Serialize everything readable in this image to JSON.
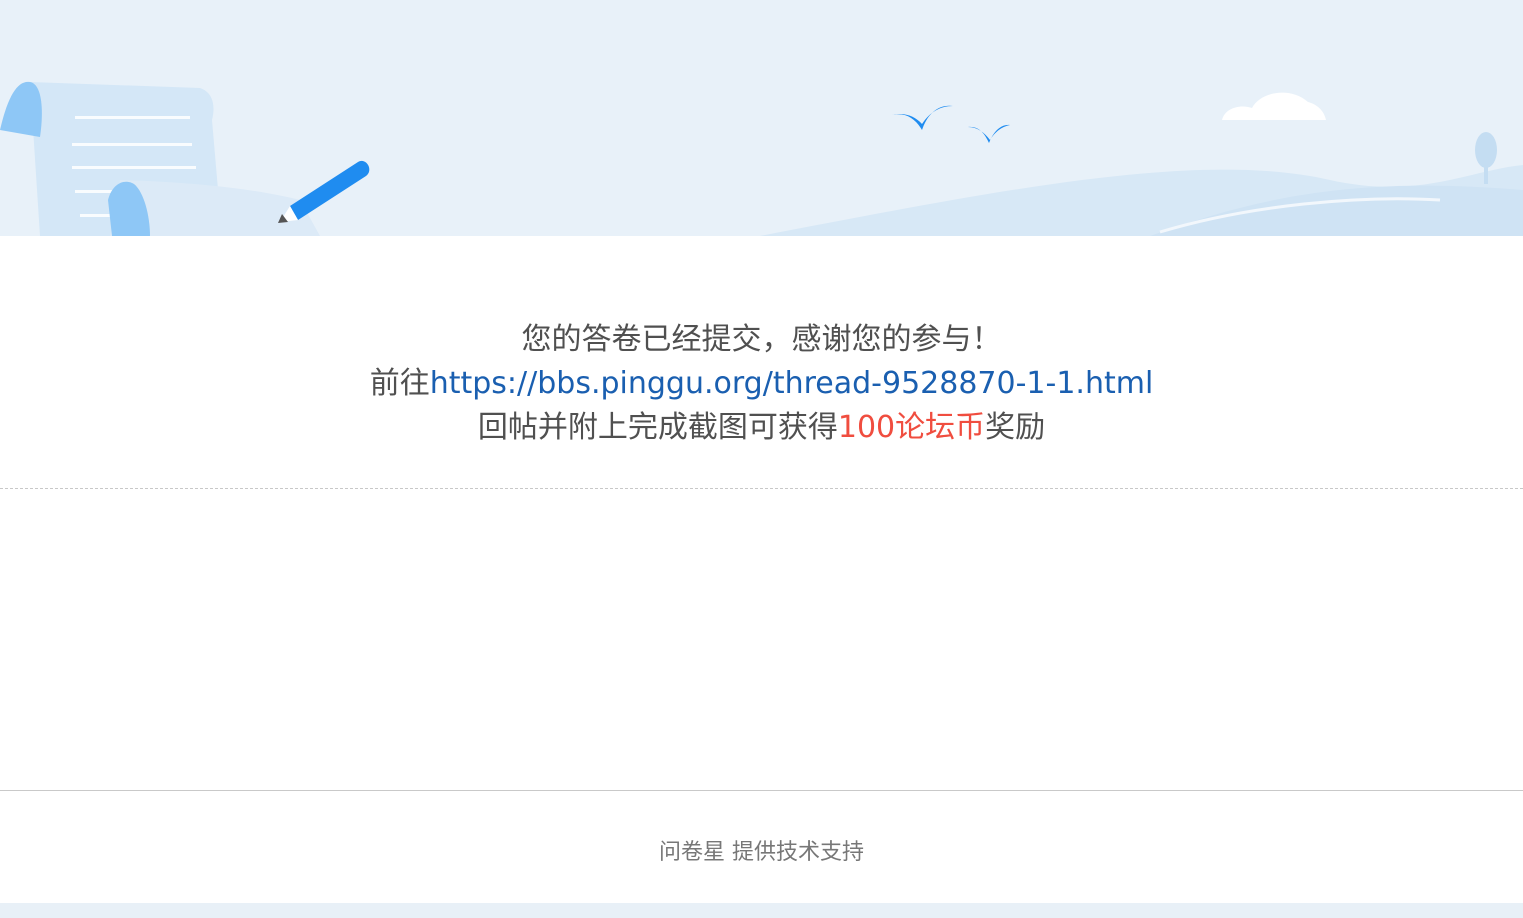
{
  "completion": {
    "line1": "您的答卷已经提交，感谢您的参与！",
    "line2_prefix": "前往",
    "link": "https://bbs.pinggu.org/thread-9528870-1-1.html",
    "line3_prefix": "回帖并附上完成截图可获得",
    "reward": "100论坛币",
    "line3_suffix": "奖励"
  },
  "footer": {
    "brand": "问卷星",
    "suffix": " 提供技术支持"
  },
  "colors": {
    "banner_bg": "#e8f1f9",
    "link": "#1a5fb0",
    "reward": "#f04d3f",
    "pen": "#1f8cf0"
  },
  "icons": {
    "banner": "paper-and-pen-illustration",
    "birds": "bird-icon",
    "cloud": "cloud-icon",
    "tree": "tree-icon"
  }
}
